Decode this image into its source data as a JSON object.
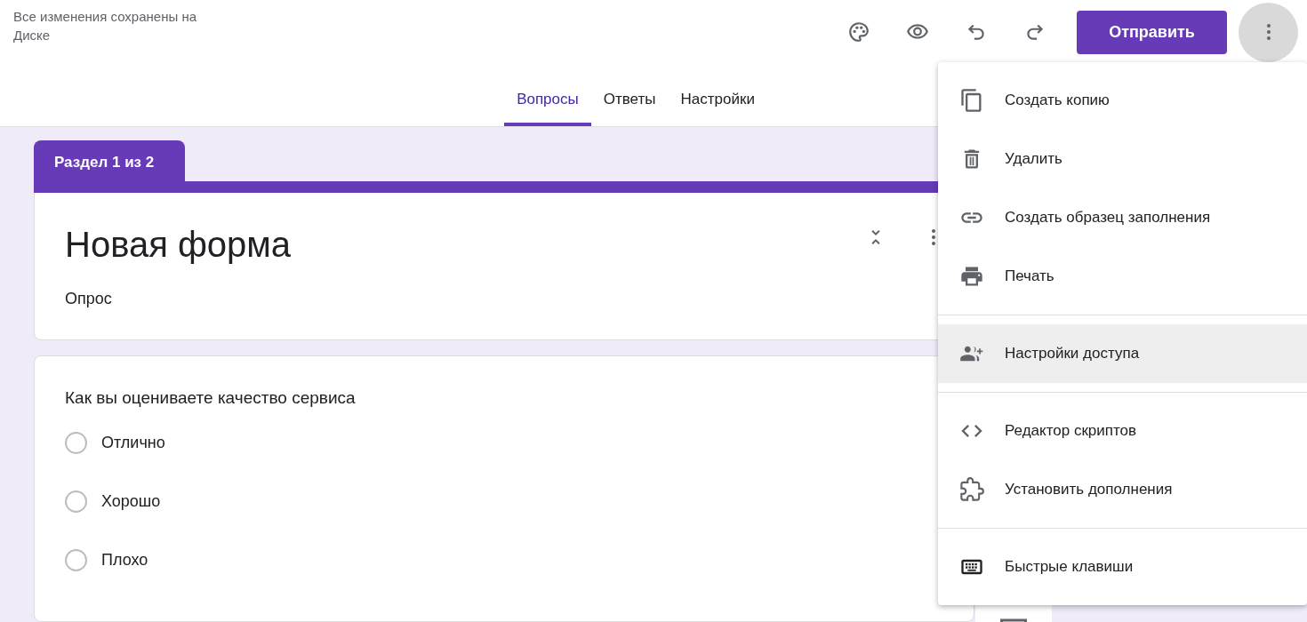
{
  "header": {
    "save_status": "Все изменения сохранены на Диске",
    "send_button": "Отправить"
  },
  "tabs": [
    {
      "label": "Вопросы",
      "selected": true
    },
    {
      "label": "Ответы",
      "selected": false
    },
    {
      "label": "Настройки",
      "selected": false
    }
  ],
  "section": {
    "label": "Раздел 1 из 2",
    "title": "Новая форма",
    "description": "Опрос"
  },
  "question": {
    "title": "Как вы оцениваете качество сервиса",
    "options": [
      {
        "label": "Отлично",
        "selected": false
      },
      {
        "label": "Хорошо",
        "selected": false
      },
      {
        "label": "Плохо",
        "selected": false
      }
    ]
  },
  "menu": {
    "groups": [
      [
        {
          "label": "Создать копию",
          "highlighted": false
        },
        {
          "label": "Удалить",
          "highlighted": false
        },
        {
          "label": "Создать образец заполнения",
          "highlighted": false
        },
        {
          "label": "Печать",
          "highlighted": false
        }
      ],
      [
        {
          "label": "Настройки доступа",
          "highlighted": true
        }
      ],
      [
        {
          "label": "Редактор скриптов",
          "highlighted": false
        },
        {
          "label": "Установить дополнения",
          "highlighted": false
        }
      ],
      [
        {
          "label": "Быстрые клавиши",
          "highlighted": false
        }
      ]
    ]
  }
}
